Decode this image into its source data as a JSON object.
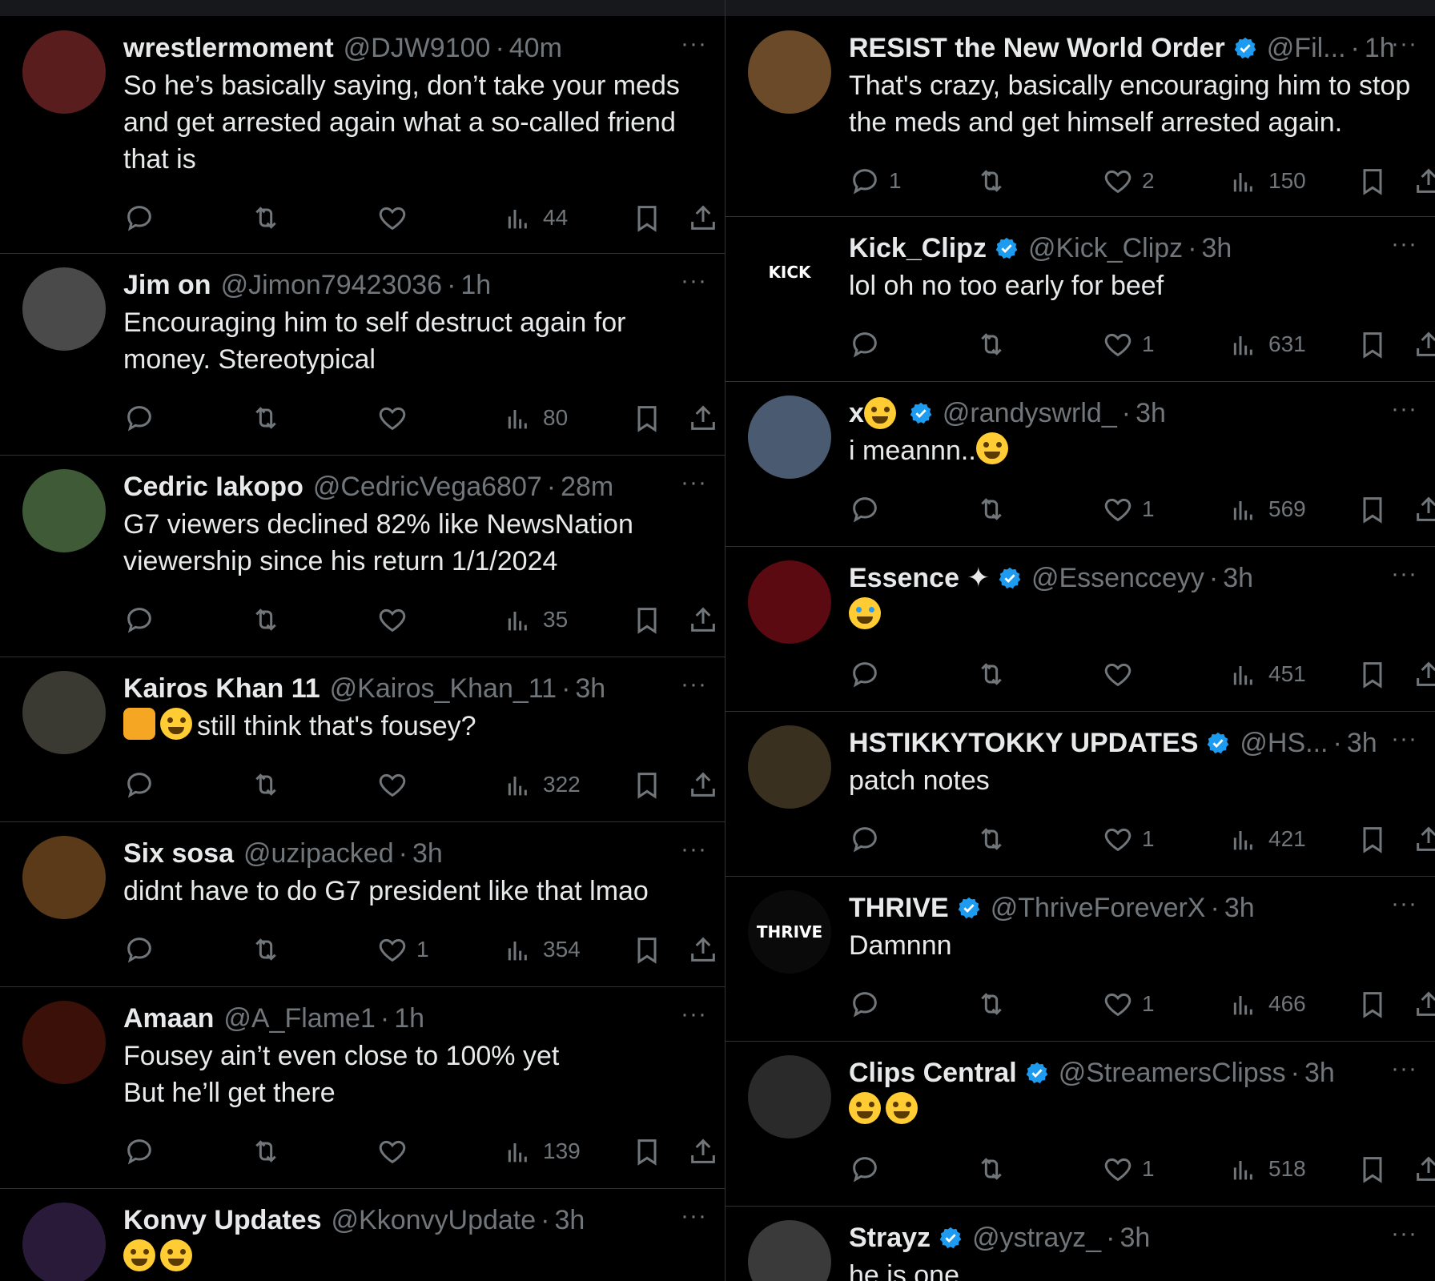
{
  "colors": {
    "background": "#000000",
    "text": "#e7e9ea",
    "muted": "#71767b",
    "verified": "#1d9bf0",
    "divider": "#2f3336"
  },
  "left_column": [
    {
      "name": "wrestlermoment",
      "handle": "@DJW9100",
      "time": "40m",
      "text": "So he’s basically saying, don’t take your meds\nand get arrested again what a so-called friend\nthat is",
      "replies": "",
      "reposts": "",
      "likes": "",
      "views": "44",
      "verified": false
    },
    {
      "name": "Jim on",
      "handle": "@Jimon79423036",
      "time": "1h",
      "text": "Encouraging him to self destruct again for\nmoney. Stereotypical",
      "replies": "",
      "reposts": "",
      "likes": "",
      "views": "80",
      "verified": false
    },
    {
      "name": "Cedric Iakopo",
      "handle": "@CedricVega6807",
      "time": "28m",
      "text": "G7 viewers declined 82% like NewsNation\nviewership since his return 1/1/2024",
      "replies": "",
      "reposts": "",
      "likes": "",
      "views": "35",
      "verified": false
    },
    {
      "name": "Kairos Khan 11",
      "handle": "@Kairos_Khan_11",
      "time": "3h",
      "text": "still think that's fousey?",
      "emoji_prefix": [
        "fist-emoji",
        "monocle-face-emoji"
      ],
      "replies": "",
      "reposts": "",
      "likes": "",
      "views": "322",
      "verified": false
    },
    {
      "name": "Six sosa",
      "handle": "@uzipacked",
      "time": "3h",
      "text": "didnt have to do G7 president like that lmao",
      "replies": "",
      "reposts": "",
      "likes": "1",
      "views": "354",
      "verified": false
    },
    {
      "name": "Amaan",
      "handle": "@A_Flame1",
      "time": "1h",
      "text": "Fousey ain’t even close to 100% yet\nBut he’ll get there",
      "replies": "",
      "reposts": "",
      "likes": "",
      "views": "139",
      "verified": false
    },
    {
      "name": "Konvy Updates",
      "handle": "@KkonvyUpdate",
      "time": "3h",
      "text": "",
      "emoji_prefix": [
        "rofl-emoji",
        "rofl-emoji"
      ],
      "verified": false
    }
  ],
  "right_column": [
    {
      "name": "RESIST the New World Order",
      "handle": "@Fil...",
      "time": "1h",
      "text": "That's crazy, basically encouraging him to stop\nthe meds and get himself arrested again.",
      "replies": "1",
      "reposts": "",
      "likes": "2",
      "views": "150",
      "verified": true
    },
    {
      "name": "Kick_Clipz",
      "handle": "@Kick_Clipz",
      "time": "3h",
      "text": "lol oh no too early for beef",
      "replies": "",
      "reposts": "",
      "likes": "1",
      "views": "631",
      "verified": true,
      "avatar_text": "KICK"
    },
    {
      "name": "x",
      "handle": "@randyswrld_",
      "time": "3h",
      "text": "i meannn..",
      "emoji_suffix": [
        "joy-emoji"
      ],
      "name_emoji": "ringed-planet-emoji",
      "replies": "",
      "reposts": "",
      "likes": "1",
      "views": "569",
      "verified": true
    },
    {
      "name": "Essence ✦",
      "handle": "@Essencceyy",
      "time": "3h",
      "text": "",
      "emoji_prefix": [
        "loudly-crying-emoji"
      ],
      "replies": "",
      "reposts": "",
      "likes": "",
      "views": "451",
      "verified": true
    },
    {
      "name": "HSTIKKYTOKKY UPDATES",
      "handle": "@HS...",
      "time": "3h",
      "text": "patch notes",
      "replies": "",
      "reposts": "",
      "likes": "1",
      "views": "421",
      "verified": true
    },
    {
      "name": "THRIVE",
      "handle": "@ThriveForeverX",
      "time": "3h",
      "text": "Damnnn",
      "replies": "",
      "reposts": "",
      "likes": "1",
      "views": "466",
      "verified": true,
      "avatar_text": "THRIVE"
    },
    {
      "name": "Clips Central",
      "handle": "@StreamersClipss",
      "time": "3h",
      "text": "",
      "emoji_prefix": [
        "joy-emoji",
        "joy-emoji"
      ],
      "replies": "",
      "reposts": "",
      "likes": "1",
      "views": "518",
      "verified": true
    },
    {
      "name": "Strayz",
      "handle": "@ystrayz_",
      "time": "3h",
      "text": "he is one",
      "verified": true
    }
  ],
  "more_label": "···",
  "dot": "·"
}
